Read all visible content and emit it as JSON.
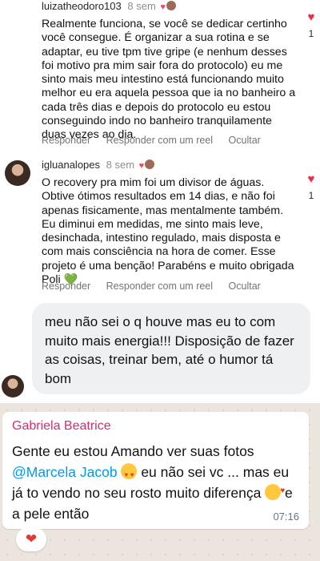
{
  "comment1": {
    "username": "luizatheodoro103",
    "time": "8 sem",
    "text": "Realmente funciona, se você se dedicar certinho você consegue. É organizar a sua rotina e se adaptar, eu tive tpm tive gripe (e nenhum desses foi motivo pra mim sair fora do protocolo) eu me sinto mais meu intestino está funcionando muito melhor eu era aquela pessoa que ia no banheiro a cada três dias e depois do protocolo eu estou conseguindo indo no banheiro tranquilamente duas vezes ao dia.",
    "actions": [
      "Responder",
      "Responder com um reel",
      "Ocultar"
    ],
    "likes": "1"
  },
  "comment2": {
    "username": "igluanalopes",
    "time": "8 sem",
    "text": "O recovery pra mim foi um divisor de águas. Obtive ótimos resultados em 14 dias, e não foi apenas fisicamente, mas mentalmente também. Eu diminui em medidas, me sinto mais leve, desinchada, intestino regulado, mais disposta e com mais consciência na hora de comer. Esse projeto é uma benção! Parabéns e muito obrigada Poli 💚",
    "actions": [
      "Responder",
      "Responder com um reel",
      "Ocultar"
    ],
    "likes": "1"
  },
  "message_gray": {
    "text": "meu não sei o q houve mas eu to com muito mais energia!!! Disposição de fazer as coisas, treinar bem, até o humor tá bom"
  },
  "whatsapp": {
    "sender": "Gabriela Beatrice",
    "text_part1": "Gente eu estou Amando ver suas fotos ",
    "mention": "@Marcela Jacob",
    "text_part2": " eu não sei vc ... mas eu já to vendo no seu rosto muito diferença ",
    "text_part3": " e a pele então",
    "time": "07:16",
    "reaction": "❤"
  },
  "colors": {
    "like_heart": "#ed2c4a",
    "sender": "#d12f6e",
    "mention": "#039be5",
    "wa_background": "#ece5dd"
  }
}
